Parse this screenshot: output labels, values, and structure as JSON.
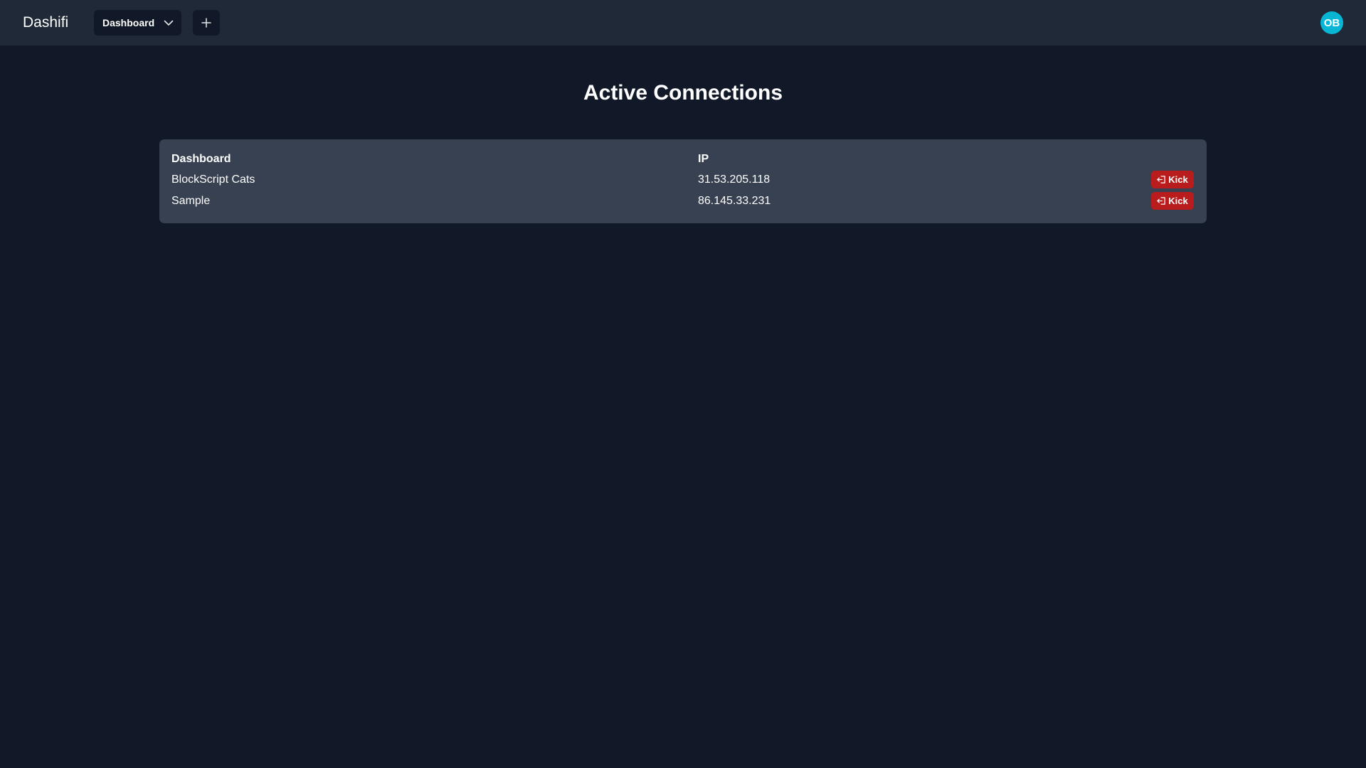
{
  "app": {
    "brand": "Dashifi"
  },
  "header": {
    "dashboard_select": {
      "selected": "Dashboard",
      "icon": "chevron-down-icon"
    },
    "add_button": {
      "icon": "plus-icon"
    },
    "avatar": {
      "initials": "OB",
      "color": "#06b6d4"
    }
  },
  "main": {
    "title": "Active Connections",
    "table": {
      "columns": [
        "Dashboard",
        "IP"
      ],
      "rows": [
        {
          "dashboard": "BlockScript Cats",
          "ip": "31.53.205.118",
          "action_label": "Kick",
          "action_icon": "logout-icon"
        },
        {
          "dashboard": "Sample",
          "ip": "86.145.33.231",
          "action_label": "Kick",
          "action_icon": "logout-icon"
        }
      ]
    }
  },
  "colors": {
    "background": "#111827",
    "topbar": "#1f2937",
    "panel": "#374151",
    "danger": "#b91c1c"
  }
}
